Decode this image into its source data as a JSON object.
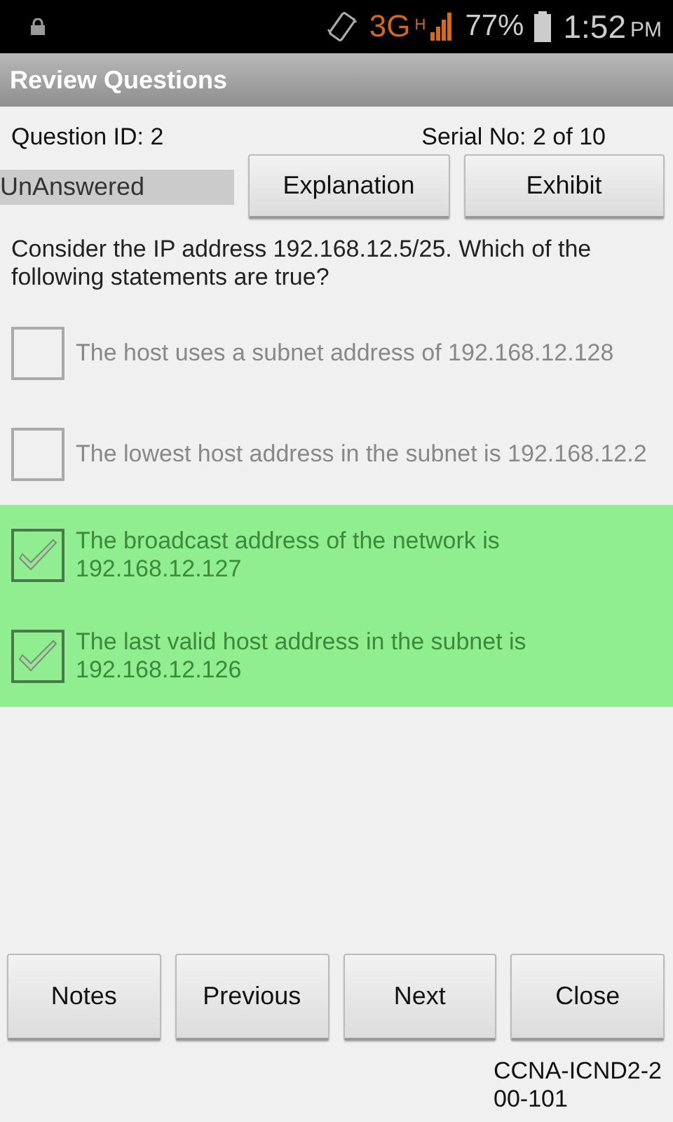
{
  "status_bar": {
    "network": "3G",
    "network_sub": "H",
    "battery": "77%",
    "time": "1:52",
    "time_suffix": "PM"
  },
  "title_bar": {
    "title": "Review Questions"
  },
  "info": {
    "question_id": "Question ID: 2",
    "serial": "Serial No: 2 of 10",
    "answer_state": "UnAnswered"
  },
  "top_buttons": [
    "Explanation",
    "Exhibit"
  ],
  "question": "Consider the IP address 192.168.12.5/25. Which of the following statements are true?",
  "options": [
    {
      "text": "The host uses a subnet address of 192.168.12.128",
      "checked": false,
      "highlighted": false
    },
    {
      "text": "The lowest host address in the subnet is 192.168.12.2",
      "checked": false,
      "highlighted": false
    },
    {
      "text": "The broadcast address of the network is 192.168.12.127",
      "checked": true,
      "highlighted": true
    },
    {
      "text": "The last valid host address in the subnet is 192.168.12.126",
      "checked": true,
      "highlighted": true
    }
  ],
  "bottom_buttons": [
    "Notes",
    "Previous",
    "Next",
    "Close"
  ],
  "footer": "CCNA-ICND2-200-101"
}
